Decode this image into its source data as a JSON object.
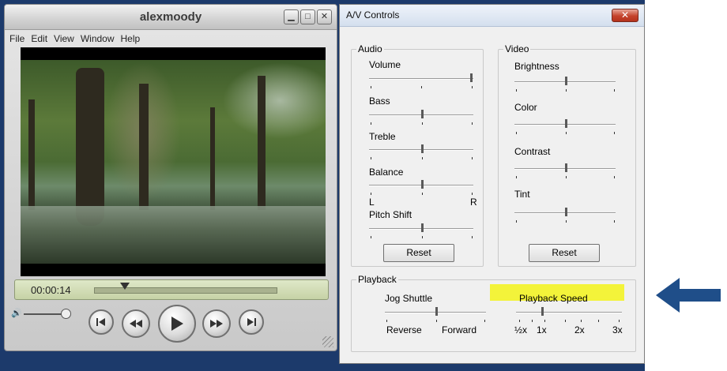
{
  "player": {
    "title": "alexmoody",
    "menu": [
      "File",
      "Edit",
      "View",
      "Window",
      "Help"
    ],
    "time": "00:00:14",
    "scrub_fraction": 0.17,
    "volume_fraction": 0.95
  },
  "dialog": {
    "title": "A/V Controls",
    "close_glyph": "✕",
    "audio": {
      "label": "Audio",
      "volume": "Volume",
      "bass": "Bass",
      "treble": "Treble",
      "balance": "Balance",
      "balance_left": "L",
      "balance_right": "R",
      "pitch_shift": "Pitch Shift",
      "reset": "Reset"
    },
    "video": {
      "label": "Video",
      "brightness": "Brightness",
      "color": "Color",
      "contrast": "Contrast",
      "tint": "Tint",
      "reset": "Reset"
    },
    "playback": {
      "label": "Playback",
      "jog_shuttle": "Jog Shuttle",
      "reverse": "Reverse",
      "forward": "Forward",
      "playback_speed": "Playback Speed",
      "speed_ticks": [
        "½x",
        "1x",
        "2x",
        "3x"
      ]
    }
  },
  "colors": {
    "highlight": "#f3f33a",
    "arrow": "#1f4e89",
    "desktop": "#1c3a6b"
  }
}
